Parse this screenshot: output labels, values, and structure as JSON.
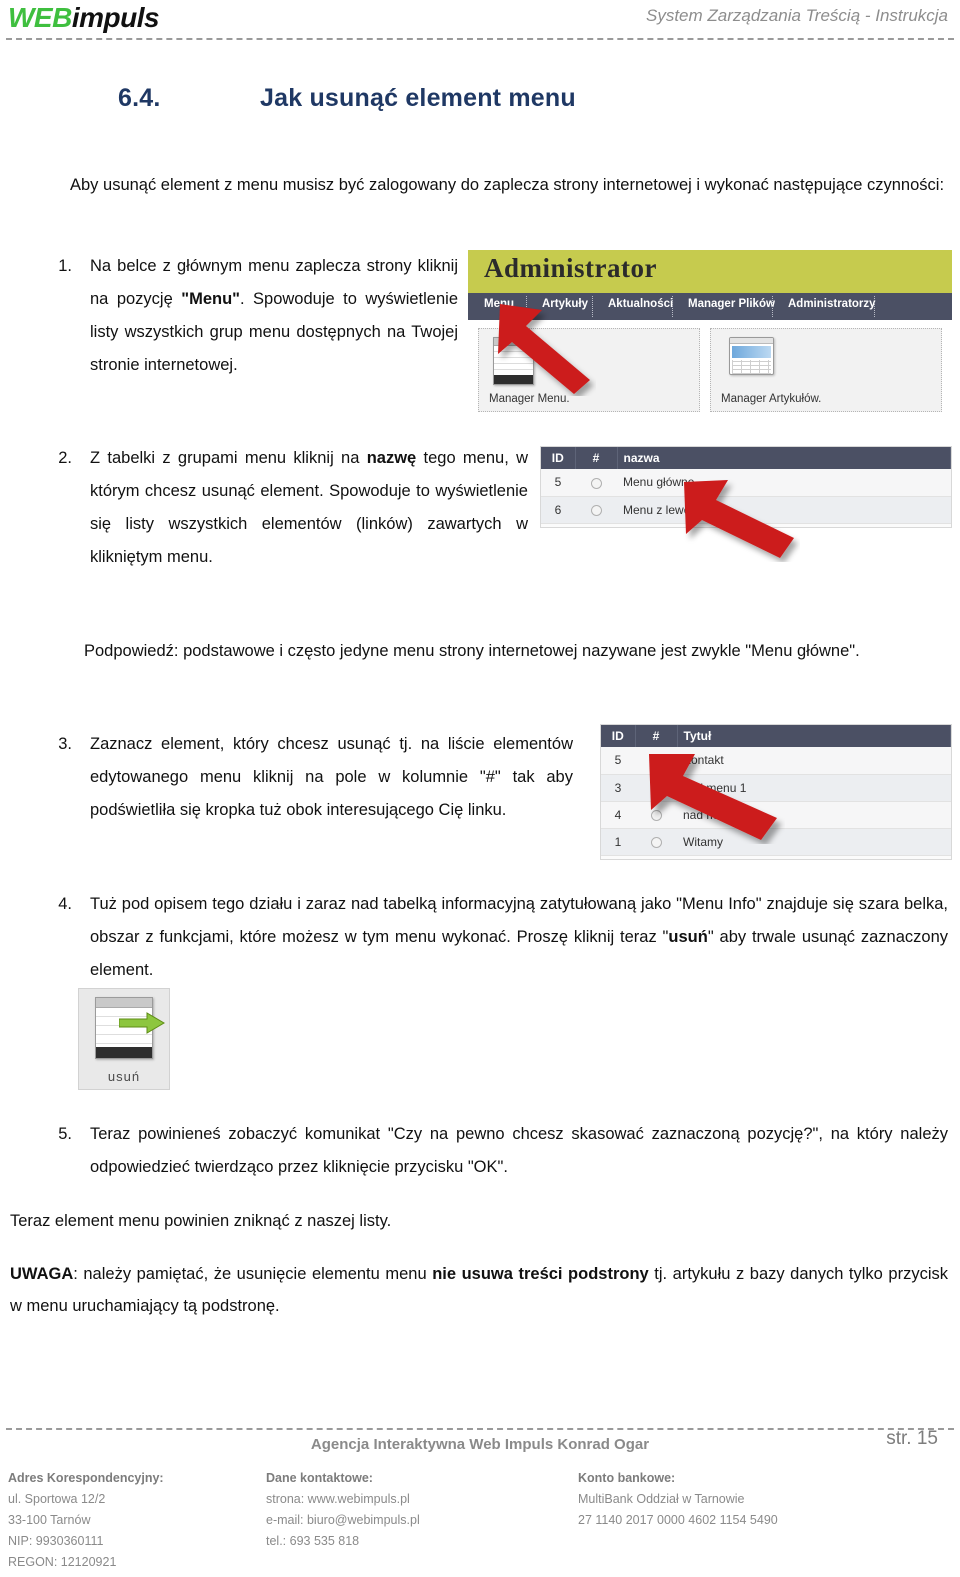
{
  "header": {
    "logo_web": "WEB",
    "logo_impuls": "impuls",
    "title": "System Zarządzania Treścią - Instrukcja"
  },
  "section": {
    "number": "6.4.",
    "title": "Jak usunąć element menu"
  },
  "intro": "Aby usunąć element z menu musisz być zalogowany do zaplecza strony internetowej i wykonać następujące czynności:",
  "steps": [
    {
      "marker": "1.",
      "text_1": "Na belce z głównym menu zaplecza strony kliknij na pozycję ",
      "bold_1": "\"Menu\"",
      "text_2": ". Spowoduje to wyświetlenie listy wszystkich grup menu dostępnych na Twojej stronie internetowej."
    },
    {
      "marker": "2.",
      "text_1": "Z tabelki z grupami menu kliknij na ",
      "bold_1": "nazwę",
      "text_2": " tego menu, w którym chcesz usunąć element. Spowoduje to wyświetlenie się listy wszystkich elementów (linków) zawartych w klikniętym menu."
    },
    {
      "marker": "3.",
      "text_1": "Zaznacz element, który chcesz usunąć  tj. na liście elementów edytowanego menu kliknij na pole w kolumnie \"#\" tak aby podświetliła się kropka tuż obok interesującego Cię linku.",
      "bold_1": "",
      "text_2": ""
    },
    {
      "marker": "4.",
      "text_1": "Tuż pod opisem tego działu i zaraz nad tabelką informacyjną zatytułowaną jako \"Menu Info\" znajduje się szara belka, obszar z funkcjami, które możesz w tym menu wykonać. Proszę kliknij teraz \"",
      "bold_1": "usuń",
      "text_2": "\" aby trwale usunąć zaznaczony element."
    },
    {
      "marker": "5.",
      "text_1": "Teraz powinieneś zobaczyć komunikat \"Czy na pewno chcesz skasować zaznaczoną pozycję?\", na który należy odpowiedzieć twierdząco przez kliknięcie przycisku \"OK\".",
      "bold_1": "",
      "text_2": ""
    }
  ],
  "hint": "Podpowiedź: podstawowe i często jedyne menu strony internetowej nazywane jest zwykle \"Menu główne\".",
  "closing": {
    "teraz": "Teraz element menu powinien zniknąć z naszej listy.",
    "uwaga_label": "UWAGA",
    "uwaga_text_1": ": należy pamiętać, że usunięcie elementu menu ",
    "uwaga_bold": "nie usuwa treści podstrony",
    "uwaga_text_2": " tj. artykułu z bazy danych tylko przycisk w menu uruchamiający tą podstronę."
  },
  "screenshot_admin": {
    "banner_word": "Administrator",
    "nav_items": [
      "Menu",
      "Artykuły",
      "Aktualności",
      "Manager Plików",
      "Administratorzy"
    ],
    "tiles": [
      {
        "caption": "Manager Menu.",
        "icon": "menu-manager-thumbnail-icon"
      },
      {
        "caption": "Manager Artykułów.",
        "icon": "article-manager-thumbnail-icon"
      }
    ],
    "banner_color": "#c6cb4e",
    "nav_color": "#4b5064"
  },
  "screenshot_groups": {
    "columns": [
      "ID",
      "#",
      "nazwa"
    ],
    "rows": [
      {
        "id": "5",
        "selected": false,
        "name": "Menu główne"
      },
      {
        "id": "6",
        "selected": false,
        "name": "Menu z lewej"
      }
    ]
  },
  "screenshot_elements": {
    "columns": [
      "ID",
      "#",
      "Tytuł"
    ],
    "rows": [
      {
        "id": "5",
        "selected": true,
        "name": "Kontakt"
      },
      {
        "id": "3",
        "selected": false,
        "name": "nad menu 1"
      },
      {
        "id": "4",
        "selected": false,
        "name": "nad menu 2"
      },
      {
        "id": "1",
        "selected": false,
        "name": "Witamy"
      }
    ]
  },
  "screenshot_usun": {
    "caption": "usuń",
    "icon": "delete-button-icon"
  },
  "footer": {
    "agency": "Agencja Interaktywna Web Impuls Konrad Ogar",
    "page": "str. 15",
    "col1": {
      "head": "Adres Korespondencyjny:",
      "lines": [
        "ul. Sportowa 12/2",
        "33-100 Tarnów",
        "NIP: 9930360111",
        "REGON: 12120921"
      ]
    },
    "col2": {
      "head": "Dane kontaktowe:",
      "lines": [
        "strona: www.webimpuls.pl",
        "e-mail: biuro@webimpuls.pl",
        "tel.: 693 535 818"
      ]
    },
    "col3": {
      "head": "Konto bankowe:",
      "lines": [
        "MultiBank Oddział w Tarnowie",
        "27 1140 2017 0000 4602 1154 5490"
      ]
    }
  }
}
